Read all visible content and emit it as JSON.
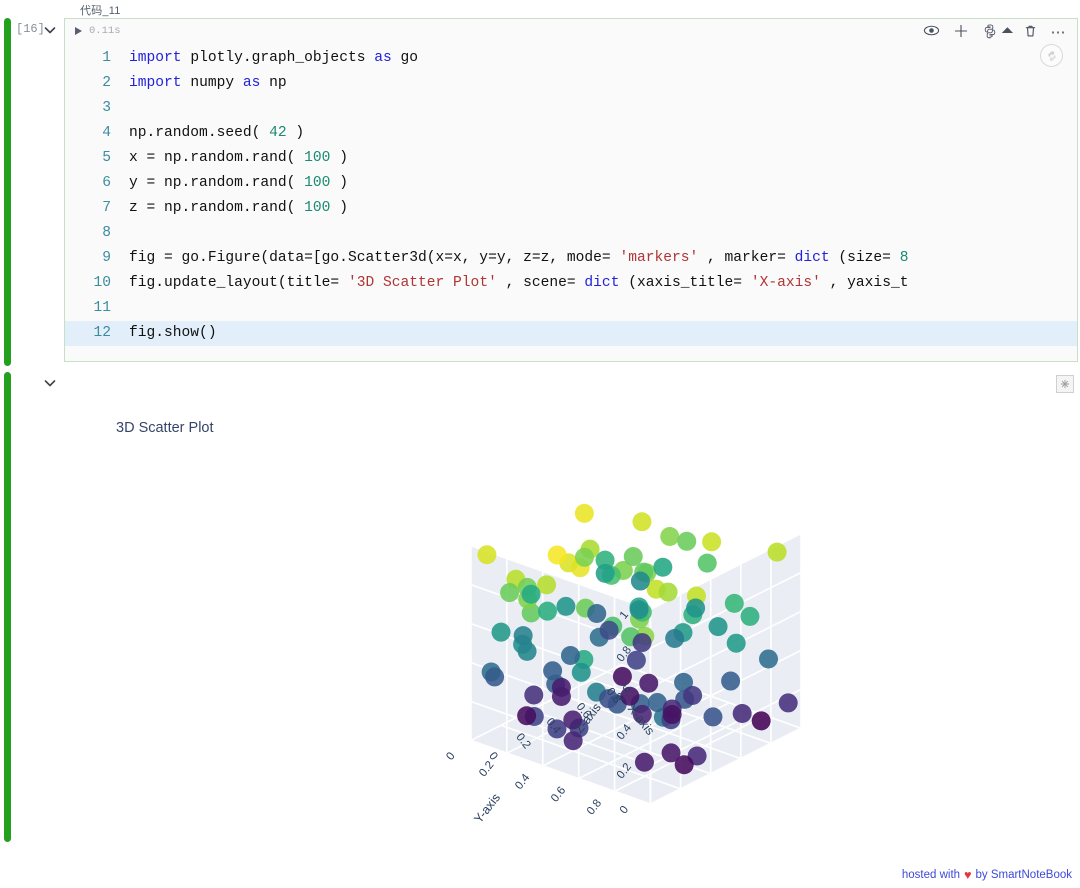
{
  "notebook": {
    "cell_tab_label": "代码_11",
    "exec_count": "[16]",
    "runtime": "0.11s",
    "toolbar": {
      "hide_label": "eye-icon",
      "add_label": "plus-icon",
      "kernel_label": "python-icon",
      "delete_label": "trash-icon",
      "more_label": "ellipsis-icon"
    }
  },
  "code": {
    "lines": [
      {
        "n": "1",
        "tokens": [
          [
            "k",
            "import "
          ],
          [
            "p",
            "plotly.graph_objects "
          ],
          [
            "k",
            "as "
          ],
          [
            "p",
            "go"
          ]
        ]
      },
      {
        "n": "2",
        "tokens": [
          [
            "k",
            "import "
          ],
          [
            "p",
            "numpy "
          ],
          [
            "k",
            "as "
          ],
          [
            "p",
            "np"
          ]
        ]
      },
      {
        "n": "3",
        "tokens": []
      },
      {
        "n": "4",
        "tokens": [
          [
            "p",
            "np.random.seed( "
          ],
          [
            "n",
            "42"
          ],
          [
            "p",
            " )"
          ]
        ]
      },
      {
        "n": "5",
        "tokens": [
          [
            "p",
            "x = np.random.rand( "
          ],
          [
            "n",
            "100"
          ],
          [
            "p",
            " )"
          ]
        ]
      },
      {
        "n": "6",
        "tokens": [
          [
            "p",
            "y = np.random.rand( "
          ],
          [
            "n",
            "100"
          ],
          [
            "p",
            " )"
          ]
        ]
      },
      {
        "n": "7",
        "tokens": [
          [
            "p",
            "z = np.random.rand( "
          ],
          [
            "n",
            "100"
          ],
          [
            "p",
            " )"
          ]
        ]
      },
      {
        "n": "8",
        "tokens": []
      },
      {
        "n": "9",
        "tokens": [
          [
            "p",
            "fig = go.Figure(data=[go.Scatter3d(x=x, y=y, z=z, mode= "
          ],
          [
            "s",
            "'markers'"
          ],
          [
            "p",
            " , marker= "
          ],
          [
            "b",
            "dict"
          ],
          [
            "p",
            " (size= "
          ],
          [
            "n",
            "8"
          ]
        ]
      },
      {
        "n": "10",
        "tokens": [
          [
            "p",
            "fig.update_layout(title= "
          ],
          [
            "s",
            "'3D Scatter Plot'"
          ],
          [
            "p",
            " , scene= "
          ],
          [
            "b",
            "dict"
          ],
          [
            "p",
            " (xaxis_title= "
          ],
          [
            "s",
            "'X-axis'"
          ],
          [
            "p",
            " , yaxis_t"
          ]
        ]
      },
      {
        "n": "11",
        "tokens": []
      },
      {
        "n": "12",
        "tokens": [
          [
            "p",
            "fig.show()"
          ]
        ],
        "highlight": true
      }
    ]
  },
  "output": {
    "snapshot_icon": "snapshot-icon"
  },
  "footer": {
    "prefix": "hosted with",
    "heart": "♥",
    "suffix": "by SmartNoteBook"
  },
  "chart_data": {
    "type": "scatter",
    "dimensions": 3,
    "title": "3D Scatter Plot",
    "xlabel": "X-axis",
    "ylabel": "Y-axis",
    "zlabel": "Z-axis",
    "marker": {
      "size": 8,
      "colorscale": "Viridis",
      "color_by": "z"
    },
    "xlim": [
      0,
      1
    ],
    "ylim": [
      0,
      1
    ],
    "zlim": [
      0,
      1
    ],
    "xticks": [
      0,
      0.2,
      0.4,
      0.6,
      0.8
    ],
    "yticks": [
      0,
      0.2,
      0.4,
      0.6,
      0.8
    ],
    "zticks": [
      0,
      0.2,
      0.4,
      0.6,
      0.8,
      1
    ],
    "grid": true,
    "legend": "none",
    "n_points": 100,
    "seed": 42,
    "points": [
      [
        0.3745,
        0.0206,
        0.6118
      ],
      [
        0.9507,
        0.9699,
        0.1395
      ],
      [
        0.732,
        0.8324,
        0.2921
      ],
      [
        0.5987,
        0.2123,
        0.3664
      ],
      [
        0.156,
        0.1818,
        0.4561
      ],
      [
        0.156,
        0.1834,
        0.7852
      ],
      [
        0.0581,
        0.3042,
        0.1997
      ],
      [
        0.8662,
        0.5248,
        0.5142
      ],
      [
        0.6011,
        0.4319,
        0.5924
      ],
      [
        0.7081,
        0.2912,
        0.0465
      ],
      [
        0.0206,
        0.6119,
        0.6075
      ],
      [
        0.9699,
        0.1395,
        0.1705
      ],
      [
        0.8324,
        0.2921,
        0.0651
      ],
      [
        0.2123,
        0.3664,
        0.9489
      ],
      [
        0.1818,
        0.4561,
        0.9656
      ],
      [
        0.1834,
        0.7852,
        0.8084
      ],
      [
        0.3042,
        0.1997,
        0.3046
      ],
      [
        0.5248,
        0.5142,
        0.0977
      ],
      [
        0.4319,
        0.5924,
        0.6842
      ],
      [
        0.2912,
        0.0465,
        0.4402
      ],
      [
        0.6119,
        0.6075,
        0.122
      ],
      [
        0.1395,
        0.1705,
        0.4952
      ],
      [
        0.2921,
        0.0651,
        0.0344
      ],
      [
        0.3664,
        0.9489,
        0.9093
      ],
      [
        0.4561,
        0.9656,
        0.2588
      ],
      [
        0.7852,
        0.8084,
        0.6625
      ],
      [
        0.1997,
        0.3046,
        0.3117
      ],
      [
        0.5142,
        0.0977,
        0.5201
      ],
      [
        0.5924,
        0.6842,
        0.5467
      ],
      [
        0.0465,
        0.4402,
        0.1849
      ],
      [
        0.6075,
        0.122,
        0.9696
      ],
      [
        0.1705,
        0.4952,
        0.7751
      ],
      [
        0.0651,
        0.0344,
        0.9395
      ],
      [
        0.9489,
        0.9093,
        0.8948
      ],
      [
        0.9656,
        0.2588,
        0.5979
      ],
      [
        0.8084,
        0.6625,
        0.9219
      ],
      [
        0.3046,
        0.3117,
        0.0885
      ],
      [
        0.0977,
        0.5201,
        0.196
      ],
      [
        0.6842,
        0.5467,
        0.0452
      ],
      [
        0.4402,
        0.1849,
        0.3253
      ],
      [
        0.122,
        0.9696,
        0.3887
      ],
      [
        0.4952,
        0.7751,
        0.2713
      ],
      [
        0.0344,
        0.9395,
        0.8287
      ],
      [
        0.9093,
        0.8948,
        0.3568
      ],
      [
        0.2588,
        0.5979,
        0.2809
      ],
      [
        0.6625,
        0.9219,
        0.5427
      ],
      [
        0.3117,
        0.0885,
        0.1409
      ],
      [
        0.5201,
        0.196,
        0.8022
      ],
      [
        0.5467,
        0.0452,
        0.0746
      ],
      [
        0.1849,
        0.3253,
        0.9869
      ],
      [
        0.9696,
        0.3887,
        0.7722
      ],
      [
        0.7751,
        0.2713,
        0.1987
      ],
      [
        0.9395,
        0.8287,
        0.0055
      ],
      [
        0.8948,
        0.3568,
        0.8155
      ],
      [
        0.5979,
        0.2809,
        0.7069
      ],
      [
        0.9219,
        0.5427,
        0.729
      ],
      [
        0.0885,
        0.1409,
        0.7712
      ],
      [
        0.196,
        0.8022,
        0.074
      ],
      [
        0.0452,
        0.0746,
        0.3585
      ],
      [
        0.3253,
        0.9869,
        0.1159
      ],
      [
        0.3887,
        0.7722,
        0.8631
      ],
      [
        0.2713,
        0.1987,
        0.6233
      ],
      [
        0.8287,
        0.0055,
        0.3309
      ],
      [
        0.3568,
        0.8155,
        0.0635
      ],
      [
        0.2809,
        0.7069,
        0.311
      ],
      [
        0.5427,
        0.729,
        0.3252
      ],
      [
        0.1409,
        0.7712,
        0.7296
      ],
      [
        0.8022,
        0.074,
        0.6376
      ],
      [
        0.0746,
        0.3585,
        0.8872
      ],
      [
        0.9869,
        0.1159,
        0.4722
      ],
      [
        0.7722,
        0.8631,
        0.1196
      ],
      [
        0.1987,
        0.6233,
        0.7132
      ],
      [
        0.0055,
        0.3309,
        0.7608
      ],
      [
        0.8155,
        0.0635,
        0.5613
      ],
      [
        0.7069,
        0.311,
        0.7709
      ],
      [
        0.729,
        0.3252,
        0.4938
      ],
      [
        0.7712,
        0.7296,
        0.5227
      ],
      [
        0.074,
        0.6376,
        0.4275
      ],
      [
        0.3585,
        0.8872,
        0.0254
      ],
      [
        0.1159,
        0.4722,
        0.1078
      ],
      [
        0.8631,
        0.1196,
        0.0314
      ],
      [
        0.6233,
        0.7132,
        0.6364
      ],
      [
        0.3309,
        0.7608,
        0.3144
      ],
      [
        0.0635,
        0.5613,
        0.5086
      ],
      [
        0.311,
        0.7709,
        0.9076
      ],
      [
        0.3252,
        0.4938,
        0.2493
      ],
      [
        0.7296,
        0.5227,
        0.4104
      ],
      [
        0.6376,
        0.4275,
        0.7556
      ],
      [
        0.8872,
        0.0254,
        0.2288
      ],
      [
        0.4722,
        0.1078,
        0.077
      ],
      [
        0.1196,
        0.0314,
        0.2899
      ],
      [
        0.7132,
        0.6364,
        0.1612
      ],
      [
        0.7608,
        0.3144,
        0.9297
      ],
      [
        0.5613,
        0.5086,
        0.8081
      ],
      [
        0.7709,
        0.9076,
        0.6334
      ],
      [
        0.4938,
        0.2493,
        0.8715
      ],
      [
        0.5227,
        0.4104,
        0.8037
      ],
      [
        0.4275,
        0.7556,
        0.1866
      ],
      [
        0.0254,
        0.2288,
        0.8926
      ],
      [
        0.1078,
        0.077,
        0.5393
      ],
      [
        0.0314,
        0.2899,
        0.8074
      ]
    ]
  }
}
